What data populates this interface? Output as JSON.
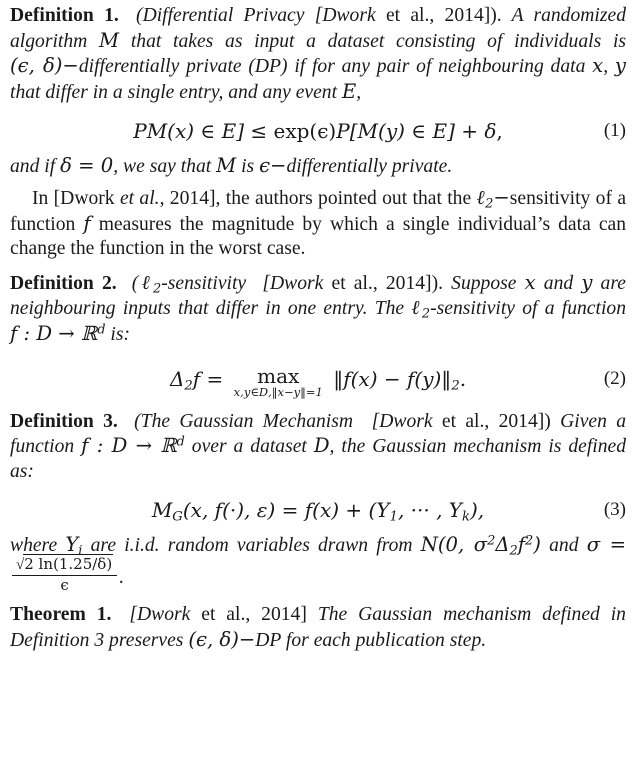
{
  "document": {
    "kind": "academic-paper-excerpt",
    "topic": "Differential Privacy definitions and Gaussian mechanism"
  },
  "definition1": {
    "heading": "Definition 1.",
    "title_open": "(Differential Privacy [Dwork",
    "title_etal": "et al., 2014]).",
    "body_line1": "A randomized algorithm",
    "sym_M": "M",
    "body_line2": "that takes as input a dataset consisting of individuals is",
    "sym_eps_delta": "(ϵ, δ)−",
    "body_line3": "differentially private (DP) if for any pair of neighbouring data",
    "sym_x": "x",
    "comma": ",",
    "sym_y": "y",
    "body_line4": "that differ in a single entry, and any event",
    "sym_E": "E",
    "body_end": ","
  },
  "equation1": {
    "number": "(1)",
    "lhs_P": "P",
    "lhs": "[M(x) ∈ E]",
    "rel": "≤",
    "exp": "exp(ϵ)",
    "rhs_P": "P",
    "rhs": "[M(y) ∈ E]",
    "plus": "+",
    "delta": "δ",
    "trailing": ",",
    "full": "P[M(x) ∈ E] ≤ exp(ϵ)P[M(y) ∈ E] + δ,"
  },
  "after_eq1": {
    "text_a": "and if",
    "sym": "δ = 0",
    "text_b": ", we say that",
    "sym_M": "M",
    "text_c": "is",
    "sym_eps": "ϵ−",
    "text_d": "differentially private."
  },
  "paragraph1": {
    "lead": "In [Dwork",
    "etal": "et al.",
    "cite": ", 2014], the authors pointed out that the",
    "ell2": "ℓ2−",
    "body": "sensitivity of a function",
    "sym_f": "f",
    "body2": "measures the magnitude by which a single individual’s data can change the function in the worst case."
  },
  "definition2": {
    "heading": "Definition 2.",
    "title_ell": "(ℓ2-sensitivity",
    "title_cite_open": "[Dwork",
    "title_etal": "et al., 2014]).",
    "body1": "Suppose",
    "sym_x": "x",
    "and": "and",
    "sym_y": "y",
    "body2": "are neighbouring inputs that differ in one entry. The",
    "ell2": "ℓ2",
    "body3": "-sensitivity of a function",
    "sym_f": "f",
    "colon": ":",
    "sym_D": "D",
    "arrow": "→",
    "sym_Rd": "ℝ",
    "sup_d": "d",
    "body4": "is:"
  },
  "equation2": {
    "number": "(2)",
    "lhs": "Δ2f",
    "eq": "=",
    "op": "max",
    "limits": "x,y∈D,‖x−y‖=1",
    "rhs": "‖f(x) − f(y)‖2.",
    "full": "Δ2f = max_{x,y∈D,‖x−y‖=1} ‖f(x) − f(y)‖2."
  },
  "definition3": {
    "heading": "Definition 3.",
    "title": "(The Gaussian Mechanism",
    "title_cite_open": "[Dwork",
    "title_etal": "et al., 2014])",
    "body1": "Given a function",
    "sym_f": "f",
    "colon": ":",
    "sym_D": "D",
    "arrow": "→",
    "sym_R": "ℝ",
    "sup_d": "d",
    "body2": "over a dataset",
    "sym_D2": "D",
    "body3": ", the Gaussian mechanism is defined as:"
  },
  "equation3": {
    "number": "(3)",
    "lhs": "MG(x, f(·), ϵ)",
    "eq": "=",
    "rhs": "f(x) + (Y1, ··· , Yk),",
    "full": "MG(x, f(·), ϵ) = f(x) + (Y1, ··· , Yk),"
  },
  "after_eq3": {
    "text_a": "where",
    "sym_Yi": "Yi",
    "text_b": "are i.i.d. random variables drawn from",
    "sym_N": "N(0, σ²Δ2f²)",
    "text_c": "and",
    "sym_sigma": "σ =",
    "frac_num": "2 ln(1.25/δ)",
    "frac_den": "ϵ",
    "period": "."
  },
  "theorem1": {
    "heading": "Theorem 1.",
    "cite_open": "[Dwork",
    "cite_etal": "et al., 2014]",
    "body1": "The Gaussian mechanism defined in Definition 3 preserves",
    "sym_eps_delta": "(ϵ, δ)−",
    "body2": "DP for each publication step."
  }
}
